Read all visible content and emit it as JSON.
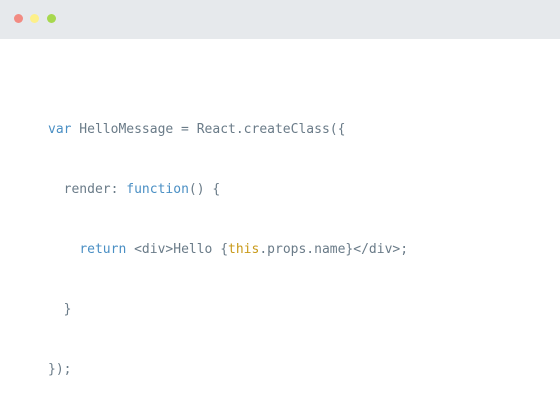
{
  "window": {
    "controls": [
      {
        "name": "close",
        "color": "#f28b82"
      },
      {
        "name": "minimize",
        "color": "#fdf08a"
      },
      {
        "name": "zoom",
        "color": "#a7d84e"
      }
    ]
  },
  "colors": {
    "titlebar": "#e6e9ec",
    "text": "#6a7b88",
    "keyword": "#4a8fc4",
    "this_keyword": "#c99a1a"
  },
  "code": {
    "line1": {
      "indent": "",
      "kw_var": "var",
      "rest": " HelloMessage = React.createClass({"
    },
    "line2": {
      "indent": "  ",
      "pre": "render: ",
      "kw_function": "function",
      "post": "() {"
    },
    "line3": {
      "indent": "    ",
      "kw_return": "return",
      "pre": " <div>Hello {",
      "kw_this": "this",
      "post": ".props.name}</div>;"
    },
    "line4": {
      "text": "  }"
    },
    "line5": {
      "text": "});"
    }
  }
}
